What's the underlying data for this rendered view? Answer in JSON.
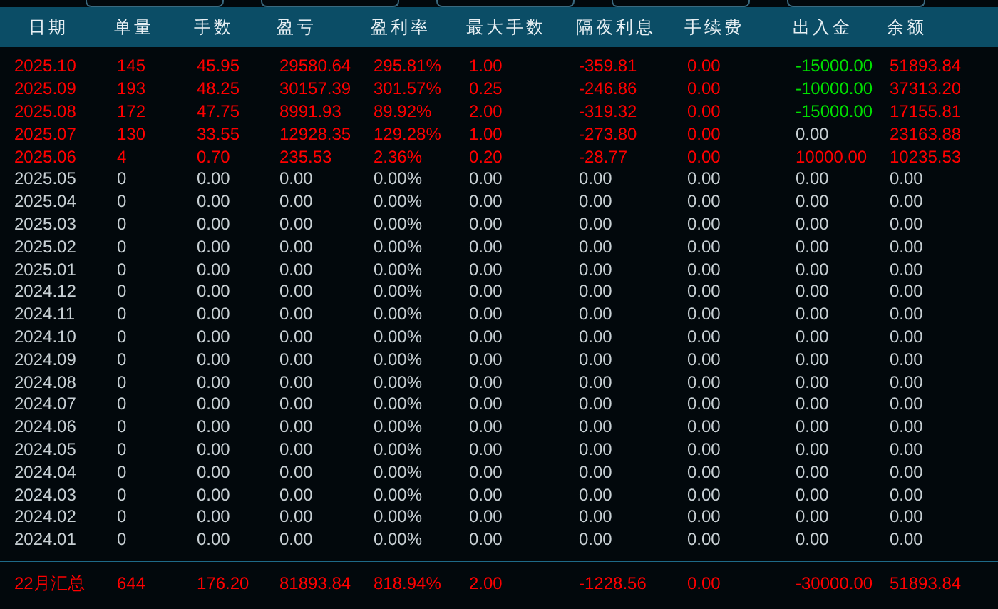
{
  "columns": [
    "日期",
    "单量",
    "手数",
    "盈亏",
    "盈利率",
    "最大手数",
    "隔夜利息",
    "手续费",
    "出入金",
    "余额"
  ],
  "rows": [
    {
      "color": "#ff0000",
      "cells": [
        "2025.10",
        "145",
        "45.95",
        "29580.64",
        "295.81%",
        "1.00",
        "-359.81",
        "0.00"
      ],
      "flow": {
        "text": "-15000.00",
        "color": "#00e000"
      },
      "balance": "51893.84"
    },
    {
      "color": "#ff0000",
      "cells": [
        "2025.09",
        "193",
        "48.25",
        "30157.39",
        "301.57%",
        "0.25",
        "-246.86",
        "0.00"
      ],
      "flow": {
        "text": "-10000.00",
        "color": "#00e000"
      },
      "balance": "37313.20"
    },
    {
      "color": "#ff0000",
      "cells": [
        "2025.08",
        "172",
        "47.75",
        "8991.93",
        "89.92%",
        "2.00",
        "-319.32",
        "0.00"
      ],
      "flow": {
        "text": "-15000.00",
        "color": "#00e000"
      },
      "balance": "17155.81"
    },
    {
      "color": "#ff0000",
      "cells": [
        "2025.07",
        "130",
        "33.55",
        "12928.35",
        "129.28%",
        "1.00",
        "-273.80",
        "0.00"
      ],
      "flow": {
        "text": "0.00",
        "color": "#c8d0d4"
      },
      "balance": "23163.88"
    },
    {
      "color": "#ff0000",
      "cells": [
        "2025.06",
        "4",
        "0.70",
        "235.53",
        "2.36%",
        "0.20",
        "-28.77",
        "0.00"
      ],
      "flow": {
        "text": "10000.00",
        "color": "#ff0000"
      },
      "balance": "10235.53"
    },
    {
      "color": "#c8d0d4",
      "cells": [
        "2025.05",
        "0",
        "0.00",
        "0.00",
        "0.00%",
        "0.00",
        "0.00",
        "0.00"
      ],
      "flow": {
        "text": "0.00",
        "color": "#c8d0d4"
      },
      "balance": "0.00"
    },
    {
      "color": "#c8d0d4",
      "cells": [
        "2025.04",
        "0",
        "0.00",
        "0.00",
        "0.00%",
        "0.00",
        "0.00",
        "0.00"
      ],
      "flow": {
        "text": "0.00",
        "color": "#c8d0d4"
      },
      "balance": "0.00"
    },
    {
      "color": "#c8d0d4",
      "cells": [
        "2025.03",
        "0",
        "0.00",
        "0.00",
        "0.00%",
        "0.00",
        "0.00",
        "0.00"
      ],
      "flow": {
        "text": "0.00",
        "color": "#c8d0d4"
      },
      "balance": "0.00"
    },
    {
      "color": "#c8d0d4",
      "cells": [
        "2025.02",
        "0",
        "0.00",
        "0.00",
        "0.00%",
        "0.00",
        "0.00",
        "0.00"
      ],
      "flow": {
        "text": "0.00",
        "color": "#c8d0d4"
      },
      "balance": "0.00"
    },
    {
      "color": "#c8d0d4",
      "cells": [
        "2025.01",
        "0",
        "0.00",
        "0.00",
        "0.00%",
        "0.00",
        "0.00",
        "0.00"
      ],
      "flow": {
        "text": "0.00",
        "color": "#c8d0d4"
      },
      "balance": "0.00"
    },
    {
      "color": "#c8d0d4",
      "cells": [
        "2024.12",
        "0",
        "0.00",
        "0.00",
        "0.00%",
        "0.00",
        "0.00",
        "0.00"
      ],
      "flow": {
        "text": "0.00",
        "color": "#c8d0d4"
      },
      "balance": "0.00"
    },
    {
      "color": "#c8d0d4",
      "cells": [
        "2024.11",
        "0",
        "0.00",
        "0.00",
        "0.00%",
        "0.00",
        "0.00",
        "0.00"
      ],
      "flow": {
        "text": "0.00",
        "color": "#c8d0d4"
      },
      "balance": "0.00"
    },
    {
      "color": "#c8d0d4",
      "cells": [
        "2024.10",
        "0",
        "0.00",
        "0.00",
        "0.00%",
        "0.00",
        "0.00",
        "0.00"
      ],
      "flow": {
        "text": "0.00",
        "color": "#c8d0d4"
      },
      "balance": "0.00"
    },
    {
      "color": "#c8d0d4",
      "cells": [
        "2024.09",
        "0",
        "0.00",
        "0.00",
        "0.00%",
        "0.00",
        "0.00",
        "0.00"
      ],
      "flow": {
        "text": "0.00",
        "color": "#c8d0d4"
      },
      "balance": "0.00"
    },
    {
      "color": "#c8d0d4",
      "cells": [
        "2024.08",
        "0",
        "0.00",
        "0.00",
        "0.00%",
        "0.00",
        "0.00",
        "0.00"
      ],
      "flow": {
        "text": "0.00",
        "color": "#c8d0d4"
      },
      "balance": "0.00"
    },
    {
      "color": "#c8d0d4",
      "cells": [
        "2024.07",
        "0",
        "0.00",
        "0.00",
        "0.00%",
        "0.00",
        "0.00",
        "0.00"
      ],
      "flow": {
        "text": "0.00",
        "color": "#c8d0d4"
      },
      "balance": "0.00"
    },
    {
      "color": "#c8d0d4",
      "cells": [
        "2024.06",
        "0",
        "0.00",
        "0.00",
        "0.00%",
        "0.00",
        "0.00",
        "0.00"
      ],
      "flow": {
        "text": "0.00",
        "color": "#c8d0d4"
      },
      "balance": "0.00"
    },
    {
      "color": "#c8d0d4",
      "cells": [
        "2024.05",
        "0",
        "0.00",
        "0.00",
        "0.00%",
        "0.00",
        "0.00",
        "0.00"
      ],
      "flow": {
        "text": "0.00",
        "color": "#c8d0d4"
      },
      "balance": "0.00"
    },
    {
      "color": "#c8d0d4",
      "cells": [
        "2024.04",
        "0",
        "0.00",
        "0.00",
        "0.00%",
        "0.00",
        "0.00",
        "0.00"
      ],
      "flow": {
        "text": "0.00",
        "color": "#c8d0d4"
      },
      "balance": "0.00"
    },
    {
      "color": "#c8d0d4",
      "cells": [
        "2024.03",
        "0",
        "0.00",
        "0.00",
        "0.00%",
        "0.00",
        "0.00",
        "0.00"
      ],
      "flow": {
        "text": "0.00",
        "color": "#c8d0d4"
      },
      "balance": "0.00"
    },
    {
      "color": "#c8d0d4",
      "cells": [
        "2024.02",
        "0",
        "0.00",
        "0.00",
        "0.00%",
        "0.00",
        "0.00",
        "0.00"
      ],
      "flow": {
        "text": "0.00",
        "color": "#c8d0d4"
      },
      "balance": "0.00"
    },
    {
      "color": "#c8d0d4",
      "cells": [
        "2024.01",
        "0",
        "0.00",
        "0.00",
        "0.00%",
        "0.00",
        "0.00",
        "0.00"
      ],
      "flow": {
        "text": "0.00",
        "color": "#c8d0d4"
      },
      "balance": "0.00"
    }
  ],
  "summary": {
    "color": "#ff0000",
    "cells": [
      "22月汇总",
      "644",
      "176.20",
      "81893.84",
      "818.94%",
      "2.00",
      "-1228.56",
      "0.00",
      "-30000.00",
      "51893.84"
    ]
  }
}
